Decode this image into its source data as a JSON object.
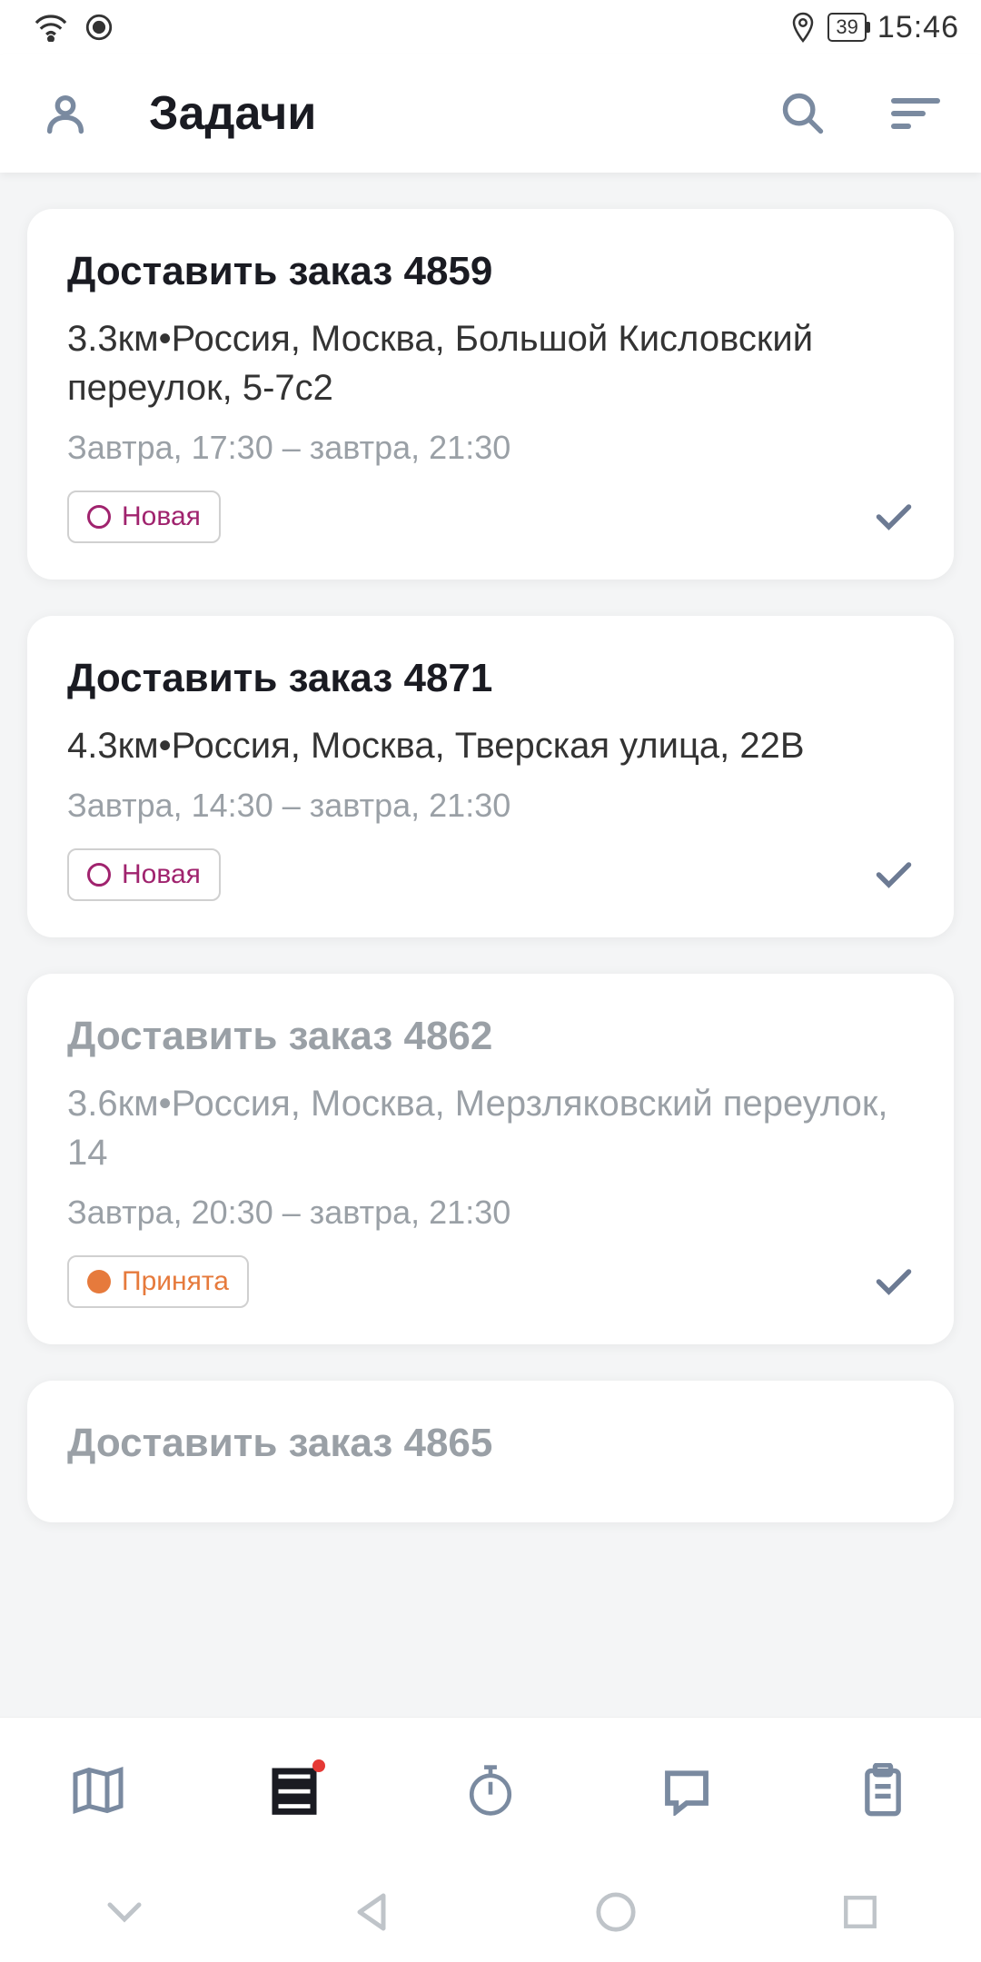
{
  "status": {
    "battery": "39",
    "time": "15:46"
  },
  "header": {
    "title": "Задачи"
  },
  "tasks": [
    {
      "title": "Доставить заказ 4859",
      "address": "3.3км•Россия, Москва, Большой Кисловский переулок, 5-7с2",
      "time": "Завтра, 17:30 – завтра, 21:30",
      "badge": "Новая",
      "badgeType": "new",
      "muted": false
    },
    {
      "title": "Доставить заказ 4871",
      "address": "4.3км•Россия, Москва, Тверская улица, 22В",
      "time": "Завтра, 14:30 – завтра, 21:30",
      "badge": "Новая",
      "badgeType": "new",
      "muted": false
    },
    {
      "title": "Доставить заказ 4862",
      "address": "3.6км•Россия, Москва, Мерзляковский переулок, 14",
      "time": "Завтра, 20:30 – завтра, 21:30",
      "badge": "Принята",
      "badgeType": "accepted",
      "muted": true
    },
    {
      "title": "Доставить заказ 4865",
      "address": "",
      "time": "",
      "badge": "",
      "badgeType": "",
      "muted": true
    }
  ],
  "bottomNav": {
    "items": [
      "map",
      "tasks",
      "timer",
      "chat",
      "clipboard"
    ],
    "active": "tasks",
    "badgeOn": "tasks"
  }
}
